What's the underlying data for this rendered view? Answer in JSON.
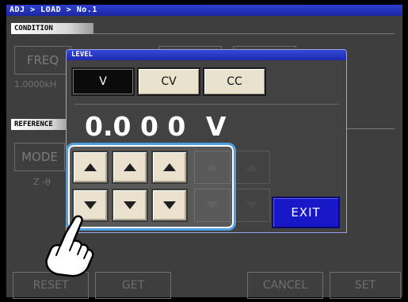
{
  "header": {
    "breadcrumb": "ADJ > LOAD > No.1"
  },
  "condition": {
    "section_label": "CONDITION",
    "freq_button": "FREQ",
    "freq_value": "1.0000kH"
  },
  "reference": {
    "section_label": "REFERENCE",
    "mode_button": "MODE",
    "z_label": "Z -θ"
  },
  "bottom_buttons": {
    "reset": "RESET",
    "get": "GET",
    "cancel": "CANCEL",
    "set": "SET"
  },
  "level_popup": {
    "title": "LEVEL",
    "modes": [
      "V",
      "CV",
      "CC"
    ],
    "selected_mode": "V",
    "value": "0.0 0 0",
    "unit": "V",
    "exit_label": "EXIT"
  },
  "colors": {
    "title_bar": "#1e2bb0",
    "exit_button": "#1818c8",
    "highlight": "#4d9fe0"
  }
}
